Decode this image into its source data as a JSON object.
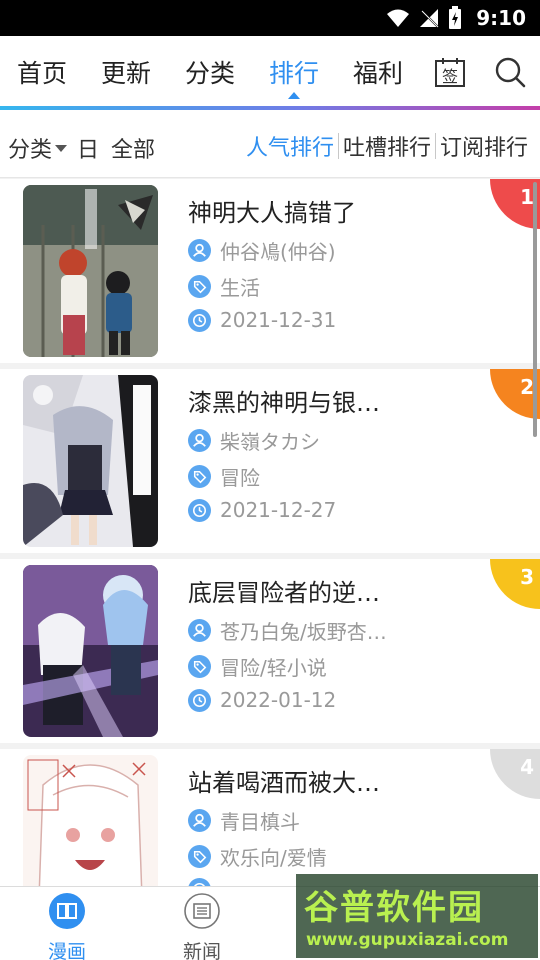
{
  "status": {
    "time": "9:10"
  },
  "nav": {
    "tabs": [
      "首页",
      "更新",
      "分类",
      "排行",
      "福利"
    ],
    "active_tab": "排行",
    "sign_label": "签"
  },
  "filter": {
    "category": "分类",
    "period": "日",
    "scope": "全部",
    "rank_tabs": [
      "人气排行",
      "吐槽排行",
      "订阅排行"
    ],
    "active_rank_tab": "人气排行"
  },
  "list": [
    {
      "rank": "1",
      "title": "神明大人搞错了",
      "author": "仲谷鳰(仲谷)",
      "tags": "生活",
      "date": "2021-12-31",
      "badge_color": "#ee4b4b"
    },
    {
      "rank": "2",
      "title": "漆黑的神明与银…",
      "author": "柴嶺タカシ",
      "tags": "冒险",
      "date": "2021-12-27",
      "badge_color": "#f5841f"
    },
    {
      "rank": "3",
      "title": "底层冒险者的逆…",
      "author": "苍乃白兔/坂野杏…",
      "tags": "冒险/轻小说",
      "date": "2022-01-12",
      "badge_color": "#f7c21c"
    },
    {
      "rank": "4",
      "title": "站着喝酒而被大…",
      "author": "青目槙斗",
      "tags": "欢乐向/爱情",
      "date": "",
      "badge_color": "#dddddd"
    }
  ],
  "bottom_tabs": [
    "漫画",
    "新闻",
    "",
    ""
  ],
  "active_bottom_tab": "漫画",
  "watermark": {
    "text": "谷普软件园",
    "url": "www.gupuxiazai.com"
  },
  "colors": {
    "accent": "#2f8ff0",
    "icon_blue": "#5aa6f0"
  }
}
